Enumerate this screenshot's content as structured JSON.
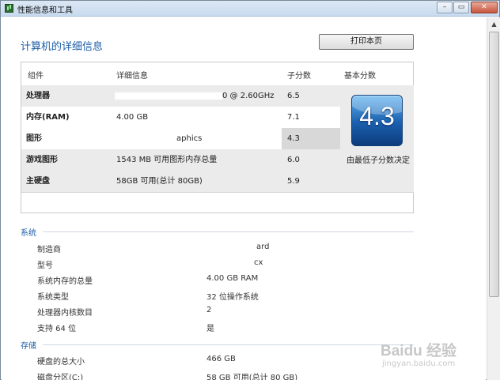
{
  "window": {
    "title": "性能信息和工具",
    "min": "–",
    "max": "▭",
    "close": "✕"
  },
  "page": {
    "title": "计算机的详细信息",
    "print_button": "打印本页"
  },
  "score_table": {
    "headers": {
      "component": "组件",
      "detail": "详细信息",
      "subscore": "子分数",
      "base": "基本分数"
    },
    "rows": [
      {
        "component": "处理器",
        "detail": "0 @ 2.60GHz",
        "subscore": "6.5"
      },
      {
        "component": "内存(RAM)",
        "detail": "4.00 GB",
        "subscore": "7.1"
      },
      {
        "component": "图形",
        "detail": "aphics",
        "subscore": "4.3"
      },
      {
        "component": "游戏图形",
        "detail": "1543 MB 可用图形内存总量",
        "subscore": "6.0"
      },
      {
        "component": "主硬盘",
        "detail": "58GB 可用(总计 80GB)",
        "subscore": "5.9"
      }
    ],
    "base_score": "4.3",
    "base_caption": "由最低子分数决定"
  },
  "system": {
    "title": "系统",
    "items": [
      {
        "label": "制造商",
        "value": "ard"
      },
      {
        "label": "型号",
        "value": "cx"
      },
      {
        "label": "系统内存的总量",
        "value": "4.00 GB RAM"
      },
      {
        "label": "系统类型",
        "value": "32 位操作系统"
      },
      {
        "label": "处理器内核数目",
        "value": "2"
      },
      {
        "label": "支持 64 位",
        "value": "是"
      }
    ]
  },
  "storage": {
    "title": "存储",
    "items": [
      {
        "label": "硬盘的总大小",
        "value": "466 GB"
      },
      {
        "label": "磁盘分区(C:)",
        "value": "58 GB 可用(总计 80 GB)"
      }
    ]
  },
  "watermark": {
    "brand": "Baidu 经验",
    "url": "jingyan.baidu.com"
  }
}
